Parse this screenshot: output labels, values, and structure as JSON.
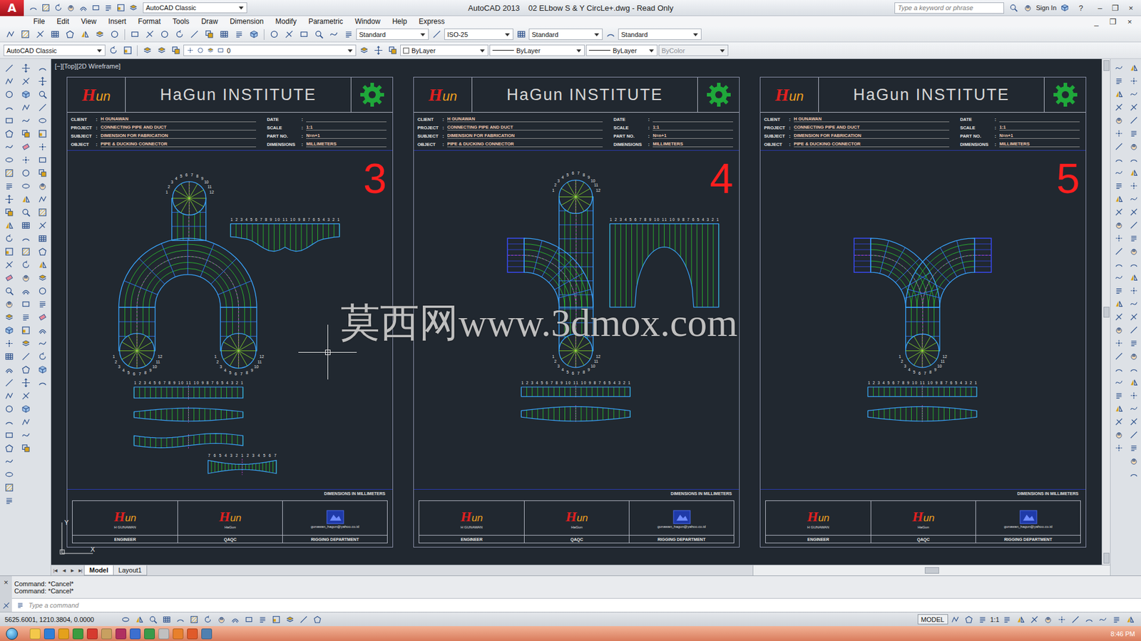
{
  "window": {
    "app_logo": "A",
    "workspace": "AutoCAD Classic",
    "title": "AutoCAD 2013    02 ELbow S & Y CircLe+.dwg - Read Only",
    "search_placeholder": "Type a keyword or phrase",
    "sign_in": "Sign In",
    "help": "?",
    "controls": [
      "–",
      "❐",
      "×"
    ]
  },
  "menu": [
    "File",
    "Edit",
    "View",
    "Insert",
    "Format",
    "Tools",
    "Draw",
    "Dimension",
    "Modify",
    "Parametric",
    "Window",
    "Help",
    "Express"
  ],
  "doc_controls": [
    "_",
    "❐",
    "×"
  ],
  "styles_toolbar": [
    "Standard",
    "ISO-25",
    "Standard",
    "Standard"
  ],
  "properties": {
    "workspace": "AutoCAD Classic",
    "layer": "0",
    "color": "ByLayer",
    "linetype": "ByLayer",
    "lineweight": "ByLayer",
    "plotstyle": "ByColor",
    "plotstyle_disabled": true
  },
  "viewport_label": "[−][Top][2D Wireframe]",
  "watermark": "莫西网www.3dmox.com",
  "ucs": {
    "x": "X",
    "y": "Y"
  },
  "title_block": {
    "heading": "HaGun INSTITUTE",
    "logo_initial": "H",
    "logo_rest": "un",
    "separator": ":",
    "fields_left": [
      {
        "label": "CLIENT",
        "value": "H GUNAWAN"
      },
      {
        "label": "PROJECT",
        "value": "CONNECTING PIPE AND DUCT"
      },
      {
        "label": "SUBJECT",
        "value": "DIMENSION FOR FABRICATION"
      },
      {
        "label": "OBJECT",
        "value": "PIPE & DUCKING CONNECTOR"
      }
    ],
    "fields_right": [
      {
        "label": "DATE",
        "value": ""
      },
      {
        "label": "SCALE",
        "value": "1:1"
      },
      {
        "label": "PART NO.",
        "value": "N=n+1"
      },
      {
        "label": "DIMENSIONS",
        "value": "MILLIMETERS"
      }
    ],
    "note": "DIMENSIONS IN MILLIMETERS",
    "signoffs": [
      {
        "name": "H GUNAWAN",
        "role": "ENGINEER",
        "kind": "logo"
      },
      {
        "name": "HaGun",
        "role": "QAQC",
        "kind": "logo"
      },
      {
        "name": "gunawan_hagun@yahoo.co.id",
        "role": "RIGGING DEPARTMENT",
        "kind": "badge"
      }
    ]
  },
  "scale_label": "1 2 3 4 5 6 7 8 9 10 11 10 9 8 7 6 5 4 3 2 1",
  "saddle_label": "7 6 5 4 3 2 1 2 3 4 5 6 7",
  "circle_labels": [
    "1",
    "2",
    "3",
    "4",
    "5",
    "6",
    "7",
    "8",
    "9",
    "10",
    "11",
    "12"
  ],
  "sheets": [
    {
      "number": "3",
      "kind": "u-branch"
    },
    {
      "number": "4",
      "kind": "tee-branch"
    },
    {
      "number": "5",
      "kind": "y-branch"
    }
  ],
  "layout_nav": [
    "|◀",
    "◀",
    "▶",
    "▶|"
  ],
  "layout_tabs": [
    {
      "label": "Model",
      "selected": true
    },
    {
      "label": "Layout1",
      "selected": false
    }
  ],
  "command": {
    "close": "×",
    "history": [
      "Command: *Cancel*",
      "Command: *Cancel*"
    ],
    "placeholder": "Type a command"
  },
  "status": {
    "coords": "5625.6001, 1210.3804, 0.0000",
    "space": "MODEL",
    "annotation_scale": "1:1"
  },
  "taskbar": {
    "clock": "8:46 PM"
  }
}
